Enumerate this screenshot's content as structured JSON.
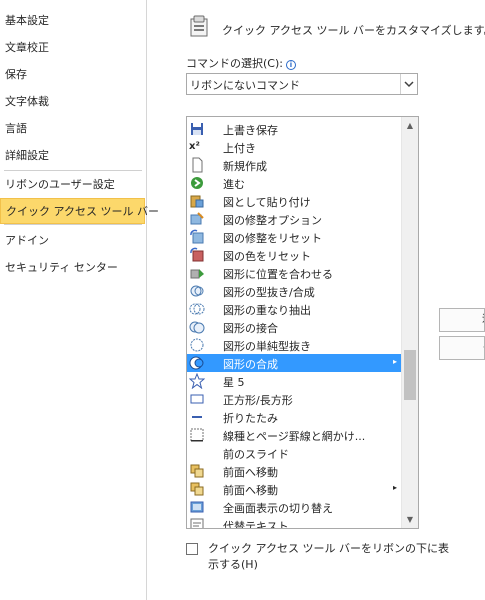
{
  "nav": {
    "items": [
      {
        "label": "基本設定"
      },
      {
        "label": "文章校正"
      },
      {
        "label": "保存"
      },
      {
        "label": "文字体裁"
      },
      {
        "label": "言語"
      },
      {
        "label": "詳細設定"
      },
      {
        "label": "リボンのユーザー設定"
      },
      {
        "label": "クイック アクセス ツール バー"
      },
      {
        "label": "アドイン"
      },
      {
        "label": "セキュリティ センター"
      }
    ]
  },
  "main": {
    "header_text": "クイック アクセス ツール バーをカスタマイズします。",
    "command_label": "コマンドの選択(C):",
    "info_glyph": "i",
    "combo_value": "リボンにないコマンド",
    "commands": [
      {
        "label": "上書き保存",
        "icon": "save-icon"
      },
      {
        "label": "上付き",
        "icon": "superscript-icon",
        "glyph": "x²"
      },
      {
        "label": "新規作成",
        "icon": "new-document-icon"
      },
      {
        "label": "進む",
        "icon": "forward-icon"
      },
      {
        "label": "図として貼り付け",
        "icon": "paste-as-picture-icon"
      },
      {
        "label": "図の修整オプション",
        "icon": "picture-correction-icon"
      },
      {
        "label": "図の修整をリセット",
        "icon": "reset-picture-icon"
      },
      {
        "label": "図の色をリセット",
        "icon": "reset-picture-color-icon"
      },
      {
        "label": "図形に位置を合わせる",
        "icon": "align-to-shape-icon"
      },
      {
        "label": "図形の型抜き/合成",
        "icon": "shape-combine-icon"
      },
      {
        "label": "図形の重なり抽出",
        "icon": "shape-intersect-icon"
      },
      {
        "label": "図形の接合",
        "icon": "shape-union-icon"
      },
      {
        "label": "図形の単純型抜き",
        "icon": "shape-subtract-icon"
      },
      {
        "label": "図形の合成",
        "icon": "shape-merge-icon",
        "selected": true,
        "submenu": "▸"
      },
      {
        "label": "星 5",
        "icon": "star-icon"
      },
      {
        "label": "正方形/長方形",
        "icon": "rectangle-icon"
      },
      {
        "label": "折りたたみ",
        "icon": "collapse-icon"
      },
      {
        "label": "線種とページ罫線と網かけ...",
        "icon": "borders-shading-icon"
      },
      {
        "label": "前のスライド",
        "icon": ""
      },
      {
        "label": "前面へ移動",
        "icon": "bring-forward-icon"
      },
      {
        "label": "前面へ移動",
        "icon": "bring-forward-icon",
        "submenu": "▸"
      },
      {
        "label": "全画面表示の切り替え",
        "icon": "full-screen-icon"
      },
      {
        "label": "代替テキスト",
        "icon": "alt-text-icon"
      }
    ],
    "scroll_up": "▲",
    "scroll_down": "▼",
    "scroll_position": 0.66,
    "checkbox_label": "クイック アクセス ツール バーをリボンの下に表示する(H)",
    "checkbox_checked": false,
    "side_buttons": [
      "追",
      "<"
    ]
  },
  "colors": {
    "selected_nav": "#fcd86b",
    "selected_item": "#3399ff"
  }
}
